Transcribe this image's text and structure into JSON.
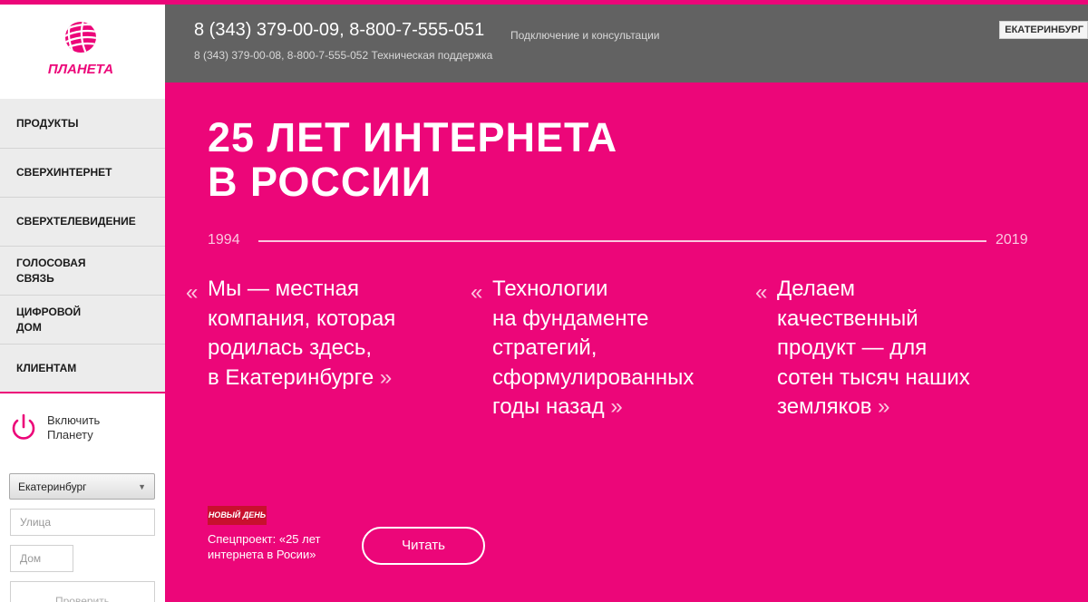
{
  "brand": {
    "name": "ПЛАНЕТА",
    "logo_icon": "planet-logo-icon",
    "accent": "#ec0679"
  },
  "sidebar": {
    "items": [
      {
        "label": "ПРОДУКТЫ"
      },
      {
        "label": "СВЕРХИНТЕРНЕТ"
      },
      {
        "label": "СВЕРХТЕЛЕВИДЕНИЕ"
      },
      {
        "label": "ГОЛОСОВАЯ\nСВЯЗЬ"
      },
      {
        "label": "ЦИФРОВОЙ\nДОМ"
      },
      {
        "label": "КЛИЕНТАМ"
      }
    ],
    "connect": {
      "icon": "power-icon",
      "label": "Включить\nПланету"
    },
    "city_select": {
      "value": "Екатеринбург"
    },
    "street": {
      "placeholder": "Улица"
    },
    "house": {
      "placeholder": "Дом"
    },
    "check_button": "Проверить"
  },
  "header": {
    "phone_main": "8 (343) 379-00-09, 8-800-7-555-051",
    "phone_main_note": "Подключение и консультации",
    "phone_tech": "8 (343) 379-00-08, 8-800-7-555-052 Техническая поддержка",
    "city": "ЕКАТЕРИНБУРГ"
  },
  "main": {
    "headline": "25 ЛЕТ ИНТЕРНЕТА\nВ РОССИИ",
    "year_start": "1994",
    "year_end": "2019",
    "quote_open": "«",
    "quote_close": "»",
    "quotes": [
      {
        "text": "Мы — местная\nкомпания, которая\nродилась здесь,\nв Екатеринбурге"
      },
      {
        "text": "Технологии\nна фундаменте\nстратегий,\nсформулированных\nгоды назад"
      },
      {
        "text": "Делаем\nкачественный\nпродукт — для\nсотен тысяч наших\nземляков"
      }
    ],
    "partner_logo": "НОВЫЙ ДЕНЬ",
    "special_project": "Спецпроект: «25 лет\nинтернета в Росии»",
    "read_button": "Читать"
  }
}
